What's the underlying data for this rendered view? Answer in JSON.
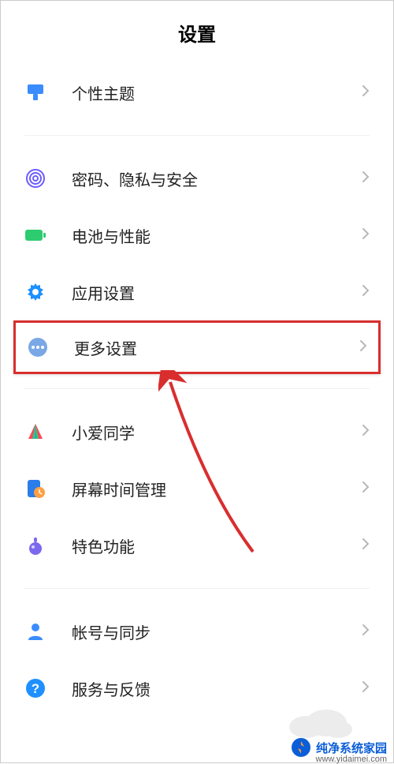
{
  "header": {
    "title": "设置"
  },
  "groups": [
    {
      "items": [
        {
          "icon": "theme-icon",
          "label": "个性主题",
          "highlight": false
        }
      ]
    },
    {
      "items": [
        {
          "icon": "fingerprint-icon",
          "label": "密码、隐私与安全",
          "highlight": false
        },
        {
          "icon": "battery-icon",
          "label": "电池与性能",
          "highlight": false
        },
        {
          "icon": "gear-icon",
          "label": "应用设置",
          "highlight": false
        },
        {
          "icon": "more-icon",
          "label": "更多设置",
          "highlight": true
        }
      ]
    },
    {
      "items": [
        {
          "icon": "xiaoai-icon",
          "label": "小爱同学",
          "highlight": false
        },
        {
          "icon": "screentime-icon",
          "label": "屏幕时间管理",
          "highlight": false
        },
        {
          "icon": "feature-icon",
          "label": "特色功能",
          "highlight": false
        }
      ]
    },
    {
      "items": [
        {
          "icon": "account-icon",
          "label": "帐号与同步",
          "highlight": false
        },
        {
          "icon": "help-icon",
          "label": "服务与反馈",
          "highlight": false
        }
      ]
    }
  ],
  "watermark": {
    "brand": "纯净系统家园",
    "url": "www.yidaimei.com"
  }
}
